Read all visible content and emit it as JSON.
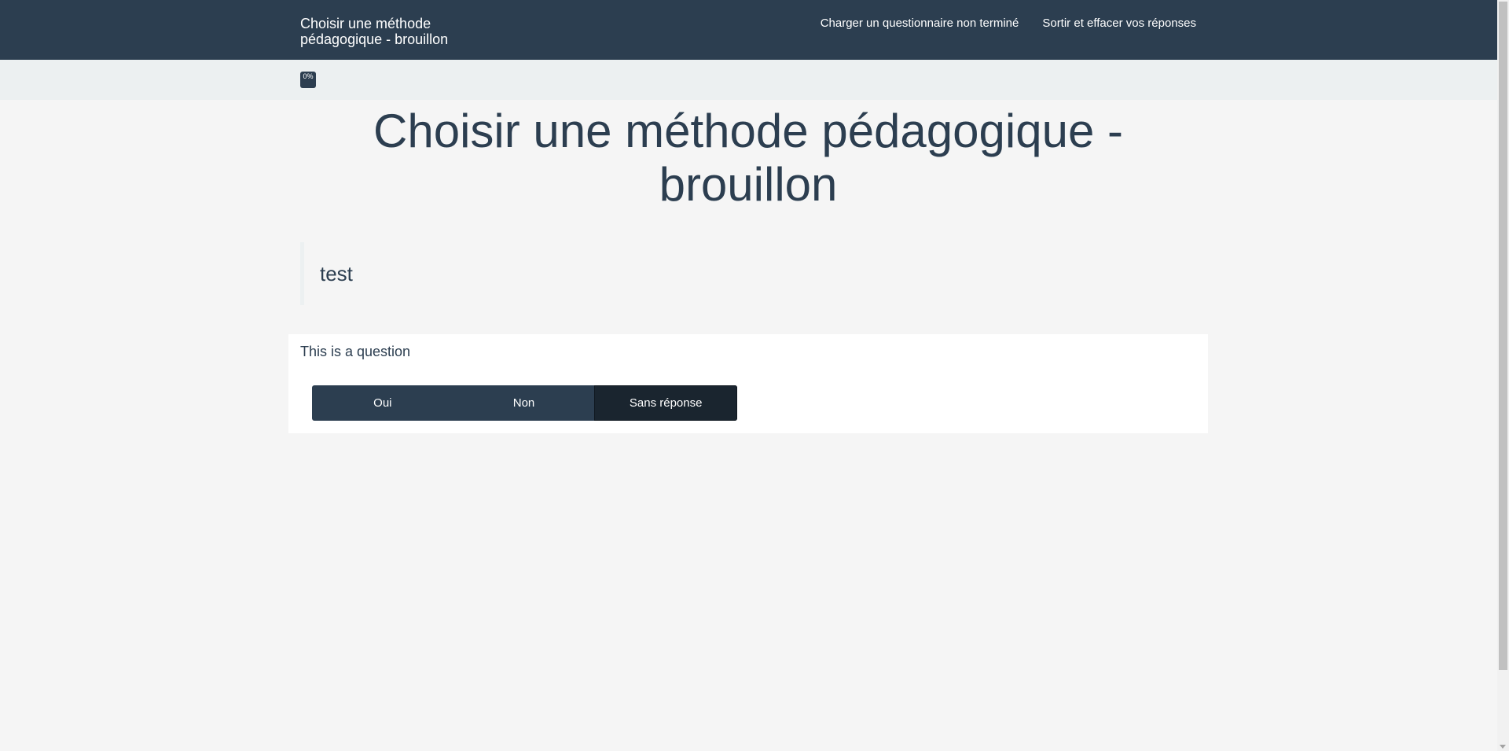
{
  "navbar": {
    "brand": "Choisir une méthode pédagogique - brouillon",
    "links": [
      {
        "label": "Charger un questionnaire non terminé"
      },
      {
        "label": "Sortir et effacer vos réponses"
      }
    ]
  },
  "progress": {
    "label": "0%",
    "value": 0
  },
  "main": {
    "title": "Choisir une méthode pédagogique - brouillon",
    "description": "test"
  },
  "question": {
    "text": "This is a question",
    "options": [
      {
        "label": "Oui"
      },
      {
        "label": "Non"
      },
      {
        "label": "Sans réponse",
        "selected": true
      }
    ]
  },
  "colors": {
    "navbar": "#2c3e50",
    "background": "#f5f5f5",
    "progress_area": "#ecf0f1",
    "button": "#2c3e50",
    "button_active": "#1a252f"
  }
}
